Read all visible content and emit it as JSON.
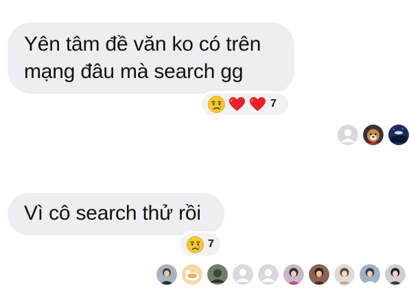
{
  "messages": [
    {
      "lines": [
        "Yên tâm đề văn ko có trên",
        "mạng đâu mà search gg"
      ],
      "reactions": [
        "crying-face",
        "red-heart",
        "red-heart"
      ],
      "reaction_count": "7",
      "seen_by": [
        "default-avatar",
        "dog-photo-avatar",
        "night-sky-avatar"
      ]
    },
    {
      "lines": [
        "Vì cô search thử rồi"
      ],
      "reactions": [
        "crying-face"
      ],
      "reaction_count": "7",
      "seen_by": [
        "portrait-avatar",
        "cartoon-avatar",
        "landscape-avatar",
        "default-avatar",
        "default-avatar",
        "portrait-avatar",
        "portrait-avatar",
        "portrait-avatar",
        "portrait-avatar",
        "portrait-avatar"
      ]
    }
  ],
  "colors": {
    "bubble": "#eeeef0",
    "text": "#111111",
    "heart": "#e8222b",
    "emoji_face": "#f9c630",
    "default_avatar_bg": "#d8d9dd"
  }
}
